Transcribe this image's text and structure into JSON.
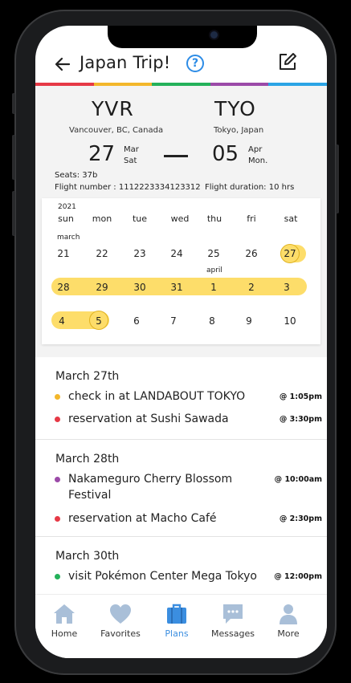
{
  "header": {
    "title": "Japan Trip!",
    "help_label": "?"
  },
  "colors": {
    "bar": [
      "#e63946",
      "#f3b72b",
      "#24b15a",
      "#9b4aa8",
      "#2ba4e5"
    ],
    "accent": "#3b8ee0",
    "highlight": "#fddd6a"
  },
  "flight": {
    "from_code": "YVR",
    "from_city": "Vancouver, BC, Canada",
    "to_code": "TYO",
    "to_city": "Tokyo, Japan",
    "dep_day": "27",
    "dep_month": "Mar",
    "dep_weekday": "Sat",
    "arr_day": "05",
    "arr_month": "Apr",
    "arr_weekday": "Mon.",
    "seats": "Seats: 37b",
    "flight_number": "Flight number : 1112223334123312",
    "duration": "Flight duration: 10 hrs"
  },
  "calendar": {
    "year": "2021",
    "weekdays": [
      "sun",
      "mon",
      "tue",
      "wed",
      "thu",
      "fri",
      "sat"
    ],
    "march_label": "march",
    "april_label": "april",
    "row1": [
      "21",
      "22",
      "23",
      "24",
      "25",
      "26",
      "27"
    ],
    "row2": [
      "28",
      "29",
      "30",
      "31",
      "1",
      "2",
      "3"
    ],
    "row3": [
      "4",
      "5",
      "6",
      "7",
      "8",
      "9",
      "10"
    ]
  },
  "events": [
    {
      "date": "March 27th",
      "items": [
        {
          "text": "check in at LANDABOUT TOKYO",
          "time": "@ 1:05pm",
          "color": "#f3b72b"
        },
        {
          "text": "reservation at Sushi Sawada",
          "time": "@ 3:30pm",
          "color": "#e63946"
        }
      ]
    },
    {
      "date": "March 28th",
      "items": [
        {
          "text_line1": "Nakameguro Cherry Blossom",
          "text_line2": "Festival",
          "time": "@ 10:00am",
          "color": "#9b4aa8"
        },
        {
          "text": "reservation at Macho Café",
          "time": "@ 2:30pm",
          "color": "#e63946"
        }
      ]
    },
    {
      "date": "March 30th",
      "items": [
        {
          "text": "visit Pokémon Center Mega Tokyo",
          "time": "@ 12:00pm",
          "color": "#24b15a"
        }
      ]
    }
  ],
  "tabs": [
    {
      "label": "Home",
      "icon": "home-icon"
    },
    {
      "label": "Favorites",
      "icon": "heart-icon"
    },
    {
      "label": "Plans",
      "icon": "suitcase-icon",
      "active": true
    },
    {
      "label": "Messages",
      "icon": "message-icon"
    },
    {
      "label": "More",
      "icon": "person-icon"
    }
  ]
}
